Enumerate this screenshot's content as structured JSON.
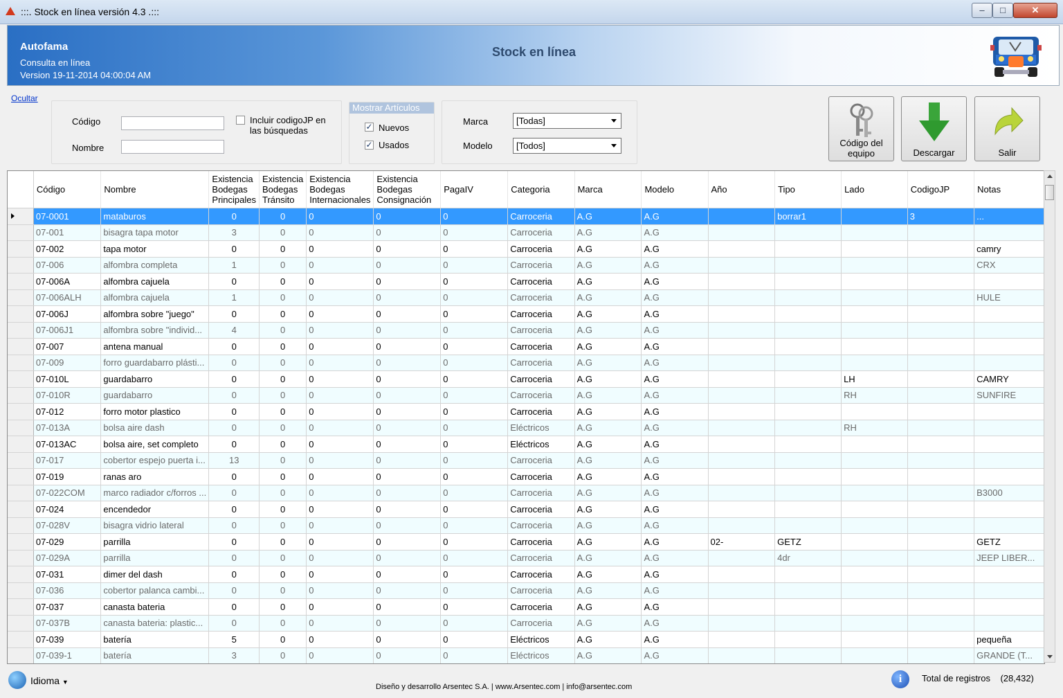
{
  "window": {
    "title": ":::. Stock en línea versión 4.3 .:::"
  },
  "header": {
    "company": "Autofama",
    "subtitle": "Consulta en línea",
    "version": "Version 19-11-2014 04:00:04 AM",
    "center_title": "Stock en línea"
  },
  "hide_link": "Ocultar",
  "search": {
    "codigo_label": "Código",
    "nombre_label": "Nombre",
    "codigo_value": "",
    "nombre_value": "",
    "include_jp_label_1": "Incluir codigoJP en",
    "include_jp_label_2": "las búsquedas",
    "include_jp_checked": false
  },
  "mostrar": {
    "title": "Mostrar Artículos",
    "nuevos_label": "Nuevos",
    "usados_label": "Usados",
    "nuevos_checked": true,
    "usados_checked": true
  },
  "filters": {
    "marca_label": "Marca",
    "marca_value": "[Todas]",
    "modelo_label": "Modelo",
    "modelo_value": "[Todos]"
  },
  "buttons": {
    "codigo_equipo_1": "Código del",
    "codigo_equipo_2": "equipo",
    "descargar": "Descargar",
    "salir": "Salir"
  },
  "columns": [
    "Código",
    "Nombre",
    "Existencia Bodegas Principales",
    "Existencia Bodegas Tránsito",
    "Existencia Bodegas Internacionales",
    "Existencia Bodegas Consignación",
    "PagaIV",
    "Categoria",
    "Marca",
    "Modelo",
    "Año",
    "Tipo",
    "Lado",
    "CodigoJP",
    "Notas"
  ],
  "rows": [
    [
      "07-0001",
      "mataburos",
      "0",
      "0",
      "0",
      "0",
      "0",
      "Carroceria",
      "A.G",
      "A.G",
      "",
      "borrar1",
      "",
      "3",
      "..."
    ],
    [
      "07-001",
      "bisagra tapa motor",
      "3",
      "0",
      "0",
      "0",
      "0",
      "Carroceria",
      "A.G",
      "A.G",
      "",
      "",
      "",
      "",
      ""
    ],
    [
      "07-002",
      "tapa motor",
      "0",
      "0",
      "0",
      "0",
      "0",
      "Carroceria",
      "A.G",
      "A.G",
      "",
      "",
      "",
      "",
      "camry"
    ],
    [
      "07-006",
      "alfombra completa",
      "1",
      "0",
      "0",
      "0",
      "0",
      "Carroceria",
      "A.G",
      "A.G",
      "",
      "",
      "",
      "",
      "CRX"
    ],
    [
      "07-006A",
      "alfombra cajuela",
      "0",
      "0",
      "0",
      "0",
      "0",
      "Carroceria",
      "A.G",
      "A.G",
      "",
      "",
      "",
      "",
      ""
    ],
    [
      "07-006ALH",
      "alfombra cajuela",
      "1",
      "0",
      "0",
      "0",
      "0",
      "Carroceria",
      "A.G",
      "A.G",
      "",
      "",
      "",
      "",
      "HULE"
    ],
    [
      "07-006J",
      "alfombra  sobre \"juego\"",
      "0",
      "0",
      "0",
      "0",
      "0",
      "Carroceria",
      "A.G",
      "A.G",
      "",
      "",
      "",
      "",
      ""
    ],
    [
      "07-006J1",
      "alfombra  sobre \"individ...",
      "4",
      "0",
      "0",
      "0",
      "0",
      "Carroceria",
      "A.G",
      "A.G",
      "",
      "",
      "",
      "",
      ""
    ],
    [
      "07-007",
      "antena manual",
      "0",
      "0",
      "0",
      "0",
      "0",
      "Carroceria",
      "A.G",
      "A.G",
      "",
      "",
      "",
      "",
      ""
    ],
    [
      "07-009",
      "forro guardabarro plásti...",
      "0",
      "0",
      "0",
      "0",
      "0",
      "Carroceria",
      "A.G",
      "A.G",
      "",
      "",
      "",
      "",
      ""
    ],
    [
      "07-010L",
      "guardabarro",
      "0",
      "0",
      "0",
      "0",
      "0",
      "Carroceria",
      "A.G",
      "A.G",
      "",
      "",
      "LH",
      "",
      "CAMRY"
    ],
    [
      "07-010R",
      "guardabarro",
      "0",
      "0",
      "0",
      "0",
      "0",
      "Carroceria",
      "A.G",
      "A.G",
      "",
      "",
      "RH",
      "",
      "SUNFIRE"
    ],
    [
      "07-012",
      "forro motor plastico",
      "0",
      "0",
      "0",
      "0",
      "0",
      "Carroceria",
      "A.G",
      "A.G",
      "",
      "",
      "",
      "",
      ""
    ],
    [
      "07-013A",
      "bolsa aire dash",
      "0",
      "0",
      "0",
      "0",
      "0",
      "Eléctricos",
      "A.G",
      "A.G",
      "",
      "",
      "RH",
      "",
      ""
    ],
    [
      "07-013AC",
      "bolsa aire, set completo",
      "0",
      "0",
      "0",
      "0",
      "0",
      "Eléctricos",
      "A.G",
      "A.G",
      "",
      "",
      "",
      "",
      ""
    ],
    [
      "07-017",
      "cobertor espejo puerta i...",
      "13",
      "0",
      "0",
      "0",
      "0",
      "Carroceria",
      "A.G",
      "A.G",
      "",
      "",
      "",
      "",
      ""
    ],
    [
      "07-019",
      "ranas aro",
      "0",
      "0",
      "0",
      "0",
      "0",
      "Carroceria",
      "A.G",
      "A.G",
      "",
      "",
      "",
      "",
      ""
    ],
    [
      "07-022COM",
      "marco radiador c/forros ...",
      "0",
      "0",
      "0",
      "0",
      "0",
      "Carroceria",
      "A.G",
      "A.G",
      "",
      "",
      "",
      "",
      "B3000"
    ],
    [
      "07-024",
      "encendedor",
      "0",
      "0",
      "0",
      "0",
      "0",
      "Carroceria",
      "A.G",
      "A.G",
      "",
      "",
      "",
      "",
      ""
    ],
    [
      "07-028V",
      "bisagra vidrio lateral",
      "0",
      "0",
      "0",
      "0",
      "0",
      "Carroceria",
      "A.G",
      "A.G",
      "",
      "",
      "",
      "",
      ""
    ],
    [
      "07-029",
      "parrilla",
      "0",
      "0",
      "0",
      "0",
      "0",
      "Carroceria",
      "A.G",
      "A.G",
      "02-",
      "GETZ",
      "",
      "",
      "GETZ"
    ],
    [
      "07-029A",
      "parrilla",
      "0",
      "0",
      "0",
      "0",
      "0",
      "Carroceria",
      "A.G",
      "A.G",
      "",
      "4dr",
      "",
      "",
      "JEEP LIBER..."
    ],
    [
      "07-031",
      "dimer del dash",
      "0",
      "0",
      "0",
      "0",
      "0",
      "Carroceria",
      "A.G",
      "A.G",
      "",
      "",
      "",
      "",
      ""
    ],
    [
      "07-036",
      "cobertor palanca cambi...",
      "0",
      "0",
      "0",
      "0",
      "0",
      "Carroceria",
      "A.G",
      "A.G",
      "",
      "",
      "",
      "",
      ""
    ],
    [
      "07-037",
      "canasta bateria",
      "0",
      "0",
      "0",
      "0",
      "0",
      "Carroceria",
      "A.G",
      "A.G",
      "",
      "",
      "",
      "",
      ""
    ],
    [
      "07-037B",
      "canasta bateria: plastic...",
      "0",
      "0",
      "0",
      "0",
      "0",
      "Carroceria",
      "A.G",
      "A.G",
      "",
      "",
      "",
      "",
      ""
    ],
    [
      "07-039",
      "batería",
      "5",
      "0",
      "0",
      "0",
      "0",
      "Eléctricos",
      "A.G",
      "A.G",
      "",
      "",
      "",
      "",
      "pequeña"
    ],
    [
      "07-039-1",
      "batería",
      "3",
      "0",
      "0",
      "0",
      "0",
      "Eléctricos",
      "A.G",
      "A.G",
      "",
      "",
      "",
      "",
      "GRANDE (T..."
    ]
  ],
  "status": {
    "idioma": "Idioma",
    "credits": "Diseño y desarrollo Arsentec S.A. | www.Arsentec.com | info@arsentec.com",
    "total_label": "Total de registros",
    "total_value": "(28,432)"
  }
}
